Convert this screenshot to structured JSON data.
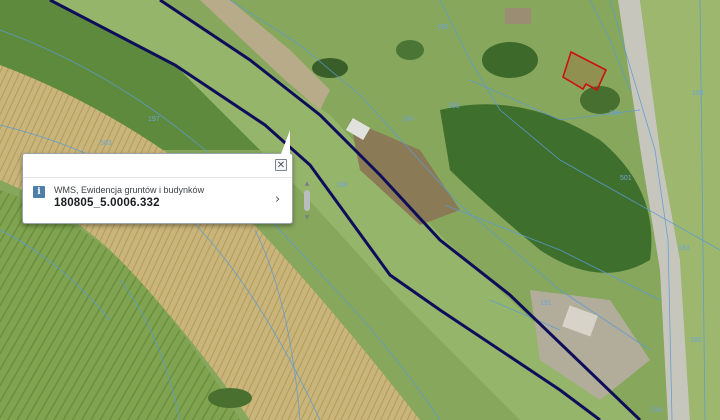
{
  "map": {
    "parcel_labels": [
      "197",
      "503",
      "108",
      "184",
      "200",
      "189",
      "185",
      "191",
      "188",
      "183",
      "182",
      "234",
      "501"
    ]
  },
  "popup": {
    "layer_name": "WMS, Ewidencja gruntów i budynków",
    "parcel_id": "180805_5.0006.332",
    "info_icon": "info-icon",
    "close_icon": "close-icon",
    "chevron_icon": "chevron-right-icon"
  },
  "colors": {
    "road_boundary": "#0d0d5a",
    "parcel_lines": "#5b9bd5",
    "building_outline": "#cc1111"
  }
}
